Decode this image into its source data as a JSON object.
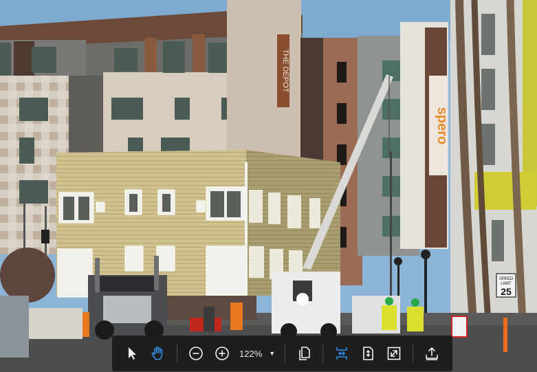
{
  "photo": {
    "storefront_sign": "THE DEPOT",
    "vertical_sign": "spero",
    "speed_sign": {
      "top": "SPEED",
      "middle": "LIMIT",
      "value": "25"
    }
  },
  "toolbar": {
    "zoom_value": "122%",
    "active_color": "#2f8fe8",
    "icon_color": "#f2f2f2"
  }
}
